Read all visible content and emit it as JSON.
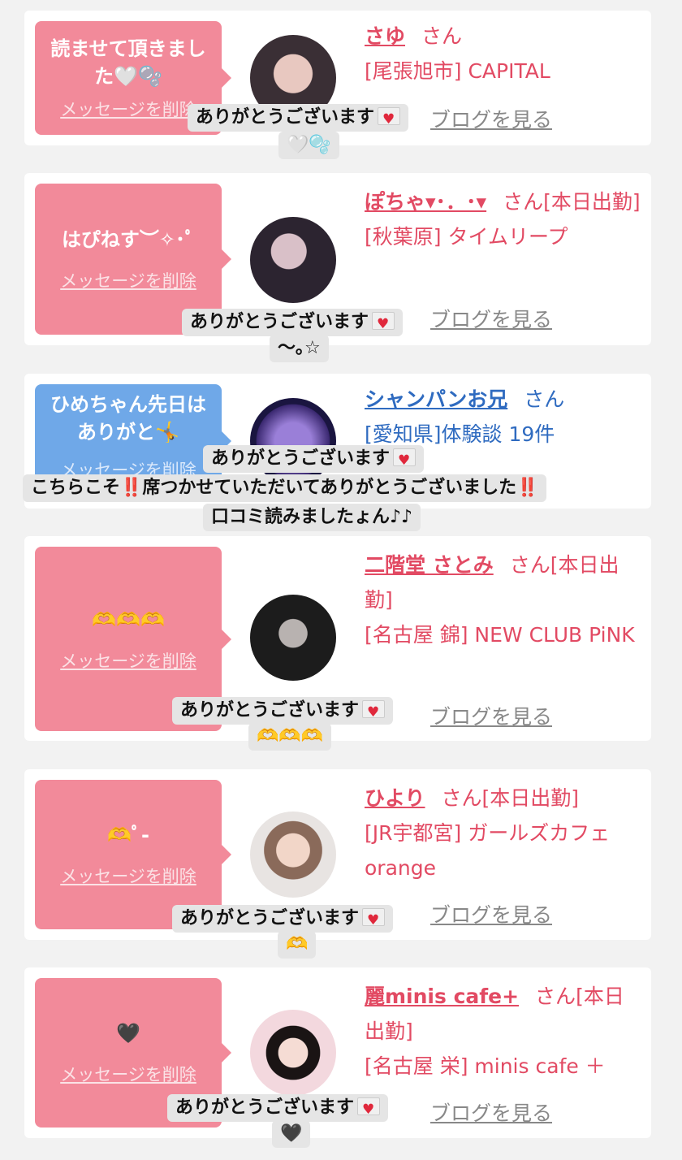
{
  "cards": [
    {
      "message": "読ませて頂きました🤍🫧",
      "delete_label": "メッセージを削除",
      "name": "さゆ",
      "san": "さん",
      "extra": "",
      "area": "[尾張旭市] CAPITAL",
      "blog": "ブログを見る",
      "reply": "ありがとうございます",
      "reply2": "🤍🫧"
    },
    {
      "message": "はぴねす︶✧･ﾟ",
      "delete_label": "メッセージを削除",
      "name": "ぽちゃ▾･．･▾",
      "san": "さん",
      "extra": "[本日出勤]",
      "area": "[秋葉原] タイムリープ",
      "blog": "ブログを見る",
      "reply": "ありがとうございます",
      "reply2": "〜｡☆"
    },
    {
      "message": "ひめちゃん先日はありがと🤸",
      "delete_label": "メッセージを削除",
      "name": "シャンパンお兄",
      "san": "さん",
      "extra": "",
      "area": "[愛知県]体験談 19件",
      "blog": "",
      "reply": "ありがとうございます",
      "reply2": "こちらこそ‼️席つかせていただいてありがとうございました‼️",
      "reply3": "口コミ読みましたょん♪♪"
    },
    {
      "message": "🫶🫶🫶",
      "delete_label": "メッセージを削除",
      "name": "二階堂 さとみ",
      "san": "さん",
      "extra": "[本日出勤]",
      "area": "[名古屋 錦] NEW CLUB PiNK",
      "blog": "ブログを見る",
      "reply": "ありがとうございます",
      "reply2": "🫶🫶🫶"
    },
    {
      "message": "🫶ﾟ-",
      "delete_label": "メッセージを削除",
      "name": "ひより",
      "san": "さん",
      "extra": "[本日出勤]",
      "area": "[JR宇都宮] ガールズカフェ orange",
      "blog": "ブログを見る",
      "reply": "ありがとうございます",
      "reply2": "🫶"
    },
    {
      "message": "🖤",
      "delete_label": "メッセージを削除",
      "name": "麗minis cafe+",
      "san": "さん",
      "extra": "[本日出勤]",
      "area": "[名古屋 栄] minis cafe ＋",
      "blog": "ブログを見る",
      "reply": "ありがとうございます",
      "reply2": "🖤"
    }
  ]
}
